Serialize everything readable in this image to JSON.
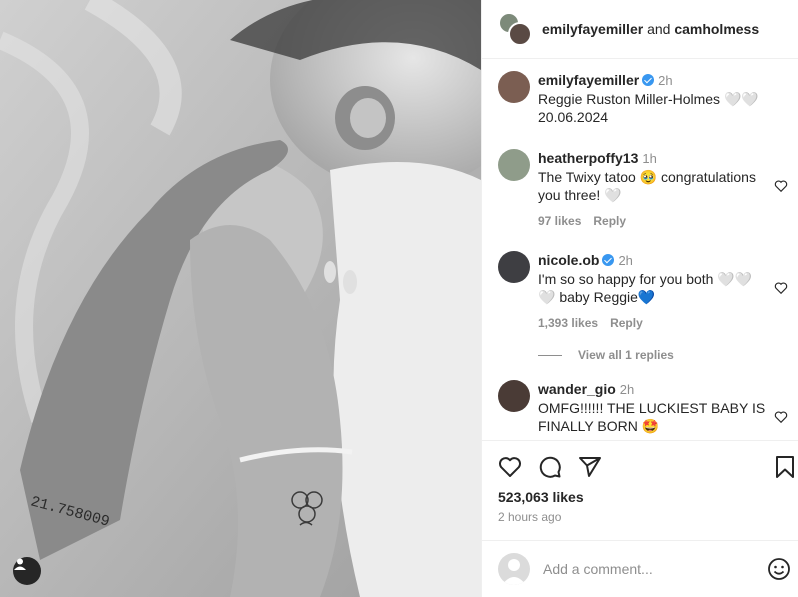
{
  "header": {
    "user1": "emilyfayemiller",
    "conjunction": "and",
    "user2": "camholmess"
  },
  "caption": {
    "user": "emilyfayemiller",
    "time": "2h",
    "line1": "Reggie Ruston Miller-Holmes 🤍🤍",
    "line2": "20.06.2024"
  },
  "comments": [
    {
      "user": "heatherpoffy13",
      "time": "1h",
      "text": "The Twixy tatoo 🥹 congratulations you three! 🤍",
      "likes": "97 likes",
      "reply": "Reply"
    },
    {
      "user": "nicole.ob",
      "time": "2h",
      "text": "I'm so so happy for you both 🤍🤍🤍 baby Reggie💙",
      "likes": "1,393 likes",
      "reply": "Reply"
    },
    {
      "user": "wander_gio",
      "time": "2h",
      "text": "OMFG!!!!!! THE LUCKIEST BABY IS FINALLY BORN 🤩",
      "likes": "",
      "reply": ""
    }
  ],
  "view_replies": "View all 1 replies",
  "likes_count": "523,063 likes",
  "posted": "2 hours ago",
  "add_comment_placeholder": "Add a comment...",
  "photo_tattoo_text": "21.758009",
  "icons": [
    "heart-icon",
    "comment-icon",
    "share-icon",
    "bookmark-icon",
    "emoji-icon",
    "user-tag-icon"
  ],
  "colors": {
    "verified": "#3897f0",
    "muted": "#8e8e8e",
    "text": "#262626"
  }
}
